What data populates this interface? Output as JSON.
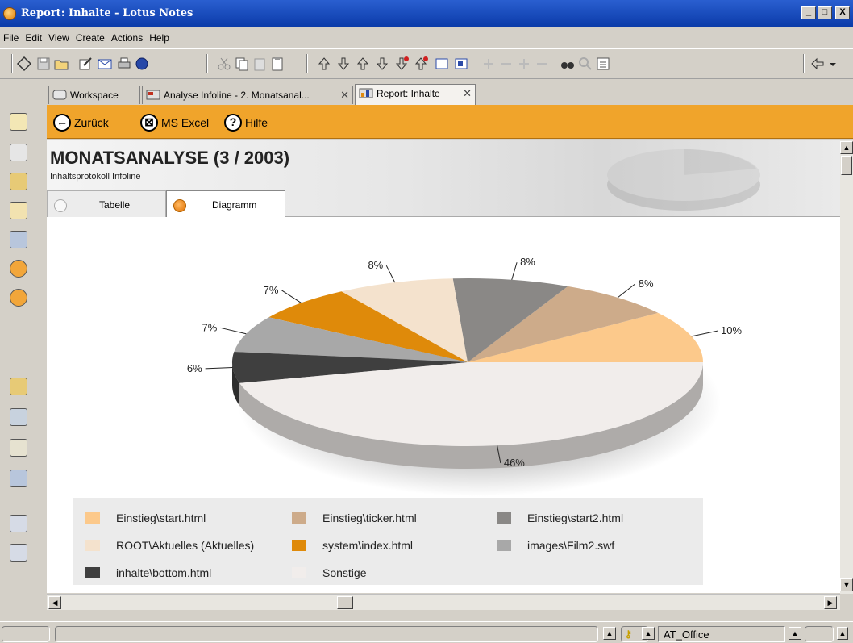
{
  "window": {
    "title": "Report: Inhalte - Lotus Notes",
    "minimize": "_",
    "restore": "□",
    "close": "X"
  },
  "menu": [
    "File",
    "Edit",
    "View",
    "Create",
    "Actions",
    "Help"
  ],
  "tabs": [
    {
      "label": "Workspace",
      "icon": "workspace-icon"
    },
    {
      "label": "Analyse Infoline - 2. Monatsanal...",
      "icon": "database-icon",
      "close": "✕"
    },
    {
      "label": "Report: Inhalte",
      "icon": "report-icon",
      "close": "✕"
    }
  ],
  "actions": {
    "back": "Zurück",
    "excel": "MS Excel",
    "help": "Hilfe"
  },
  "report": {
    "title": "MONATSANALYSE (3 / 2003)",
    "subtitle": "Inhaltsprotokoll Infoline"
  },
  "view_tabs": {
    "tabelle": "Tabelle",
    "diagramm": "Diagramm"
  },
  "status": {
    "location": "AT_Office"
  },
  "colors": {
    "orange_bar": "#f0a42b",
    "title_bar": "#0a3aa8"
  },
  "chart_data": {
    "type": "pie",
    "labels": [
      "Einstieg\\start.html",
      "Einstieg\\ticker.html",
      "Einstieg\\start2.html",
      "ROOT\\Aktuelles (Aktuelles)",
      "system\\index.html",
      "images\\Film2.swf",
      "inhalte\\bottom.html",
      "Sonstige"
    ],
    "values": [
      10,
      8,
      8,
      8,
      7,
      7,
      6,
      46
    ],
    "data_labels": [
      "10%",
      "8%",
      "8%",
      "8%",
      "7%",
      "7%",
      "6%",
      "46%"
    ],
    "colors": [
      "#fcc98b",
      "#cdab8a",
      "#8a8886",
      "#f4e2cd",
      "#df8a0a",
      "#a8a8a8",
      "#3f3f3f",
      "#f1edeb"
    ],
    "legend_position": "bottom",
    "style": "3d"
  }
}
